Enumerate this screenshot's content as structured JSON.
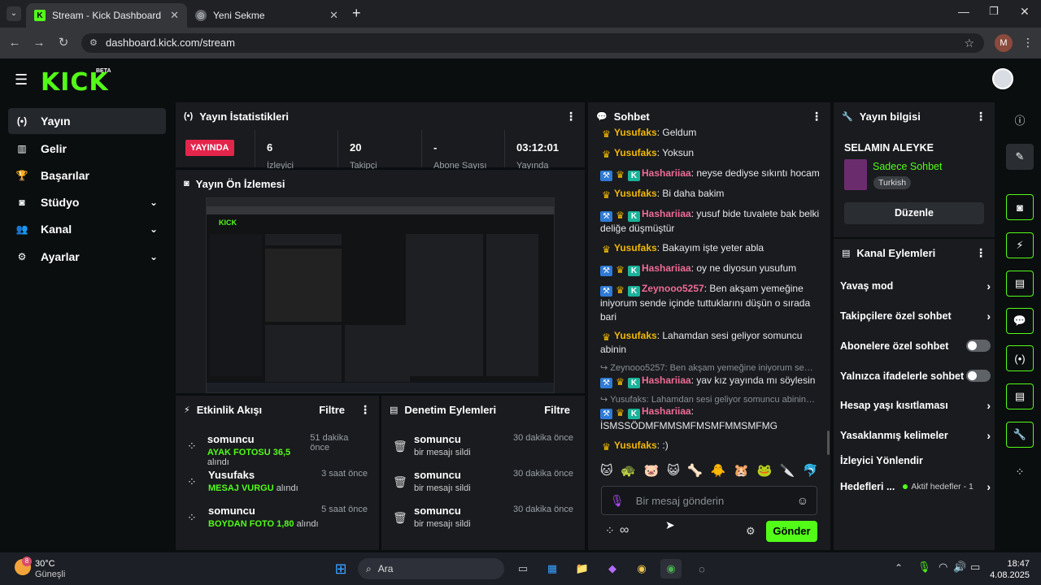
{
  "browser": {
    "tabs": [
      {
        "title": "Stream - Kick Dashboard"
      },
      {
        "title": "Yeni Sekme"
      }
    ],
    "url": "dashboard.kick.com/stream",
    "profile": "M"
  },
  "site": {
    "logo": "KICK",
    "beta": "BETA"
  },
  "sidebar": {
    "items": [
      {
        "label": "Yayın",
        "icon": "broadcast-icon"
      },
      {
        "label": "Gelir",
        "icon": "chart-icon"
      },
      {
        "label": "Başarılar",
        "icon": "trophy-icon"
      },
      {
        "label": "Stüdyo",
        "icon": "studio-icon"
      },
      {
        "label": "Kanal",
        "icon": "users-icon"
      },
      {
        "label": "Ayarlar",
        "icon": "gear-icon"
      }
    ]
  },
  "stats": {
    "title": "Yayın İstatistikleri",
    "status": "YAYINDA",
    "values": [
      {
        "value": "6",
        "label": "İzleyici"
      },
      {
        "value": "20",
        "label": "Takipçi"
      },
      {
        "value": "-",
        "label": "Abone Sayısı"
      },
      {
        "value": "03:12:01",
        "label": "Yayında"
      }
    ]
  },
  "preview": {
    "title": "Yayın Ön İzlemesi"
  },
  "activity": {
    "title": "Etkinlik Akışı",
    "filter": "Filtre",
    "items": [
      {
        "name": "somuncu",
        "time": "51 dakika önce",
        "highlight": "AYAK FOTOSU 36,5",
        "suffix": "alındı"
      },
      {
        "name": "Yusufaks",
        "time": "3 saat önce",
        "highlight": "MESAJ VURGU",
        "suffix": "alındı"
      },
      {
        "name": "somuncu",
        "time": "5 saat önce",
        "highlight": "BOYDAN FOTO 1,80",
        "suffix": "alındı"
      }
    ]
  },
  "moderation": {
    "title": "Denetim Eylemleri",
    "filter": "Filtre",
    "items": [
      {
        "name": "somuncu",
        "time": "30 dakika önce",
        "action": "bir mesajı sildi"
      },
      {
        "name": "somuncu",
        "time": "30 dakika önce",
        "action": "bir mesajı sildi"
      },
      {
        "name": "somuncu",
        "time": "30 dakika önce",
        "action": "bir mesajı sildi"
      }
    ]
  },
  "chat": {
    "title": "Sohbet",
    "messages": [
      {
        "user": "Yusufaks",
        "text": "Geldum"
      },
      {
        "user": "Yusufaks",
        "text": "Yoksun"
      },
      {
        "user": "Hashariiaa",
        "text": "neyse dediyse sıkıntı hocam"
      },
      {
        "user": "Yusufaks",
        "text": "Bi daha bakim"
      },
      {
        "user": "Hashariiaa",
        "text": "yusuf bide tuvalete bak belki deliğe düşmüştür"
      },
      {
        "user": "Yusufaks",
        "text": "Bakayım işte yeter abla"
      },
      {
        "user": "Hashariiaa",
        "text": "oy ne diyosun yusufum"
      },
      {
        "user": "Zeynooo5257",
        "text": "Ben akşam yemeğine iniyorum sende içinde tuttuklarını düşün o sırada bari"
      },
      {
        "user": "Yusufaks",
        "text": "Lahamdan sesi geliyor somuncu abinin"
      },
      {
        "reply": "Zeynooo5257: Ben akşam yemeğine iniyorum sen...",
        "user": "Hashariiaa",
        "text": "yav kız yayında mı söylesin"
      },
      {
        "reply": "Yusufaks: Lahamdan sesi geliyor somuncu abinin i...",
        "user": "Hashariiaa",
        "text": "İSMSSÖDMFMMSMFMSMFMMSMFMG"
      },
      {
        "user": "Yusufaks",
        "text": ":)"
      }
    ],
    "input_placeholder": "Bir mesaj gönderin",
    "send": "Gönder"
  },
  "info": {
    "title": "Yayın bilgisi",
    "stream_title": "SELAMIN ALEYKE",
    "category": "Sadece Sohbet",
    "language": "Turkish",
    "edit": "Düzenle"
  },
  "channel_actions": {
    "title": "Kanal Eylemleri",
    "items": [
      {
        "label": "Yavaş mod",
        "type": "arrow"
      },
      {
        "label": "Takipçilere özel sohbet",
        "type": "arrow"
      },
      {
        "label": "Abonelere özel sohbet",
        "type": "toggle"
      },
      {
        "label": "Yalnızca ifadelerle sohbet",
        "type": "toggle"
      },
      {
        "label": "Hesap yaşı kısıtlaması",
        "type": "arrow"
      },
      {
        "label": "Yasaklanmış kelimeler",
        "type": "arrow"
      },
      {
        "label": "İzleyici Yönlendir",
        "type": "none"
      },
      {
        "label": "Hedefleri ...",
        "type": "goal",
        "status": "Aktif hedefler - 1"
      }
    ]
  },
  "taskbar": {
    "weather_temp": "30°C",
    "weather_desc": "Güneşli",
    "weather_badge": "8",
    "search": "Ara",
    "time": "18:47",
    "date": "4.08.2025"
  },
  "colors": {
    "accent": "#53fc18",
    "live": "#e4254b"
  }
}
